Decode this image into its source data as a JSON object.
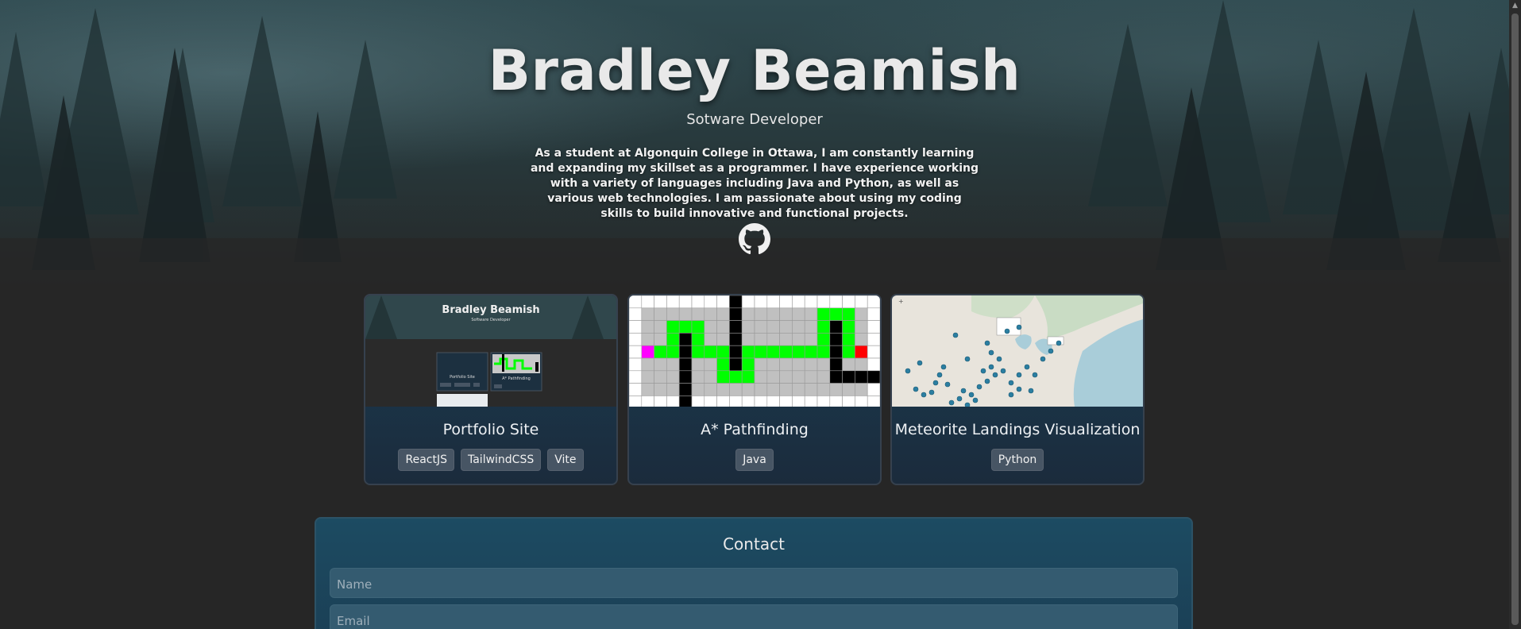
{
  "hero": {
    "name": "Bradley Beamish",
    "role": "Sotware Developer",
    "bio": "As a student at Algonquin College in Ottawa, I am constantly learning and expanding my skillset as a programmer. I have experience working with a variety of languages including Java and Python, as well as various web technologies. I am passionate about using my coding skills to build innovative and functional projects.",
    "github_icon": "github-icon"
  },
  "projects": [
    {
      "title": "Portfolio Site",
      "tags": [
        "ReactJS",
        "TailwindCSS",
        "Vite"
      ],
      "preview": {
        "name": "Bradley Beamish",
        "role": "Software Developer",
        "card1": "Portfolio Site",
        "card2": "A* Pathfinding"
      }
    },
    {
      "title": "A* Pathfinding",
      "tags": [
        "Java"
      ]
    },
    {
      "title": "Meteorite Landings Visualization",
      "tags": [
        "Python"
      ]
    }
  ],
  "contact": {
    "heading": "Contact",
    "name_placeholder": "Name",
    "email_placeholder": "Email"
  },
  "colors": {
    "page_bg": "#262626",
    "card_bg": "#1b2b3c",
    "tag_bg": "#475564",
    "contact_bg": "#1c4b62",
    "path_green": "#00ff00",
    "start_magenta": "#ff00ff",
    "end_red": "#ff0000"
  }
}
